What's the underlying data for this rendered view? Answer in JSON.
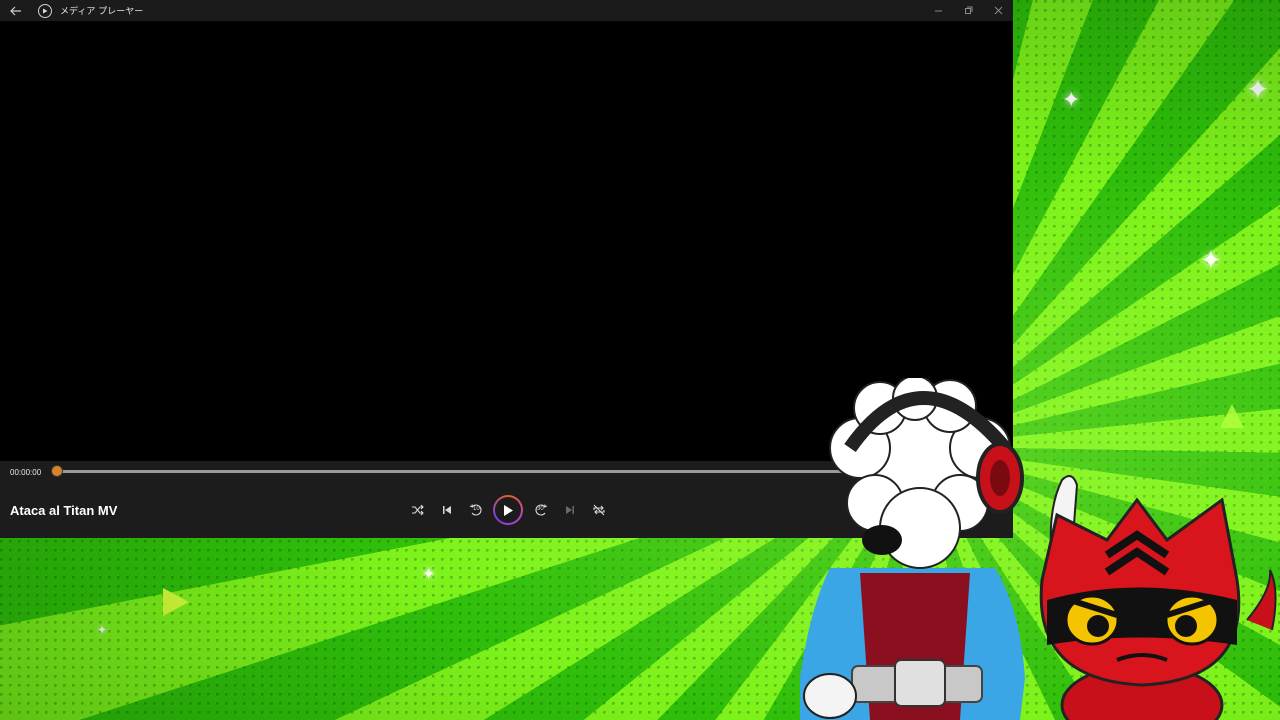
{
  "window": {
    "title": "メディア プレーヤー"
  },
  "player": {
    "current_time": "00:00:00",
    "progress": 0,
    "media_title": "Ataca al Titan MV"
  },
  "icons": {
    "back": "back-arrow-icon",
    "app": "media-player-icon",
    "minimize": "minimize-icon",
    "maximize": "maximize-icon",
    "close": "close-icon",
    "shuffle": "shuffle-icon",
    "previous": "previous-track-icon",
    "rewind": "rewind-10-icon",
    "play": "play-icon",
    "forward": "forward-30-icon",
    "next": "next-track-icon",
    "repeat": "repeat-off-icon"
  },
  "labels": {
    "rewind_seconds": "10",
    "forward_seconds": "30"
  },
  "colors": {
    "accent_thumb": "#d9822b",
    "background_green": "#3ad10e"
  }
}
